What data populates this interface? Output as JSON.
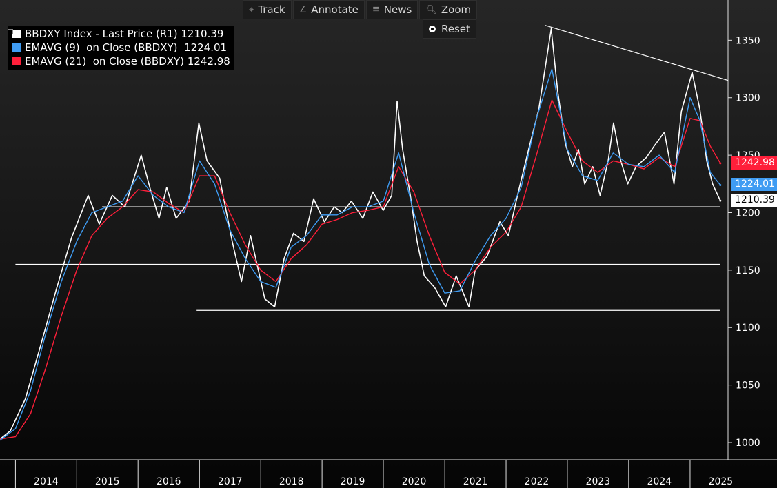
{
  "toolbar": {
    "items": [
      {
        "label": "Track",
        "icon": "crosshair-icon",
        "glyph": "⌖"
      },
      {
        "label": "Annotate",
        "icon": "pencil-icon",
        "glyph": "∠"
      },
      {
        "label": "News",
        "icon": "news-icon",
        "glyph": "≣"
      },
      {
        "label": "Zoom",
        "icon": "magnifier-icon",
        "glyph": "🔍︎"
      }
    ],
    "reset_label": "Reset"
  },
  "legend": {
    "entries": [
      {
        "label": "BBDXY Index - Last Price (R1) 1210.39",
        "color": "#ffffff"
      },
      {
        "label": "EMAVG (9)  on Close (BBDXY)  1224.01",
        "color": "#3f9cf3"
      },
      {
        "label": "EMAVG (21)  on Close (BBDXY) 1242.98",
        "color": "#ff1f3a"
      }
    ]
  },
  "price_tags": {
    "ema21": {
      "text": "1242.98",
      "value": 1242.98,
      "bg": "#ff1f3a",
      "fg": "#ffffff"
    },
    "ema9": {
      "text": "1224.01",
      "value": 1224.01,
      "bg": "#3f9cf3",
      "fg": "#ffffff"
    },
    "last": {
      "text": "1210.39",
      "value": 1210.39,
      "bg": "#ffffff",
      "fg": "#000000"
    }
  },
  "chart_data": {
    "type": "line",
    "title": "",
    "xlabel": "",
    "ylabel": "",
    "ylim": [
      985,
      1385
    ],
    "xlim": [
      "2013-10-01",
      "2025-08-15"
    ],
    "y_ticks": [
      1000,
      1050,
      1100,
      1150,
      1200,
      1250,
      1300,
      1350
    ],
    "x_ticks": [
      "2014",
      "2015",
      "2016",
      "2017",
      "2018",
      "2019",
      "2020",
      "2021",
      "2022",
      "2023",
      "2024",
      "2025"
    ],
    "grid": false,
    "legend_position": "top-left",
    "price_axis_side": "right",
    "series": [
      {
        "name": "BBDXY Index - Last Price (R1)",
        "color": "#ffffff",
        "x": [
          "2013-10-01",
          "2013-12-01",
          "2014-03-01",
          "2014-06-01",
          "2014-09-01",
          "2014-12-01",
          "2015-03-10",
          "2015-05-15",
          "2015-08-01",
          "2015-10-15",
          "2016-01-20",
          "2016-03-15",
          "2016-05-05",
          "2016-06-20",
          "2016-08-15",
          "2016-11-01",
          "2016-12-28",
          "2017-02-15",
          "2017-05-01",
          "2017-07-15",
          "2017-09-08",
          "2017-11-01",
          "2018-01-25",
          "2018-03-25",
          "2018-05-20",
          "2018-07-15",
          "2018-09-15",
          "2018-11-12",
          "2019-01-15",
          "2019-03-15",
          "2019-05-01",
          "2019-06-25",
          "2019-09-01",
          "2019-10-31",
          "2019-12-31",
          "2020-02-20",
          "2020-03-23",
          "2020-04-25",
          "2020-06-10",
          "2020-07-20",
          "2020-09-01",
          "2020-11-01",
          "2021-01-06",
          "2021-03-10",
          "2021-05-25",
          "2021-07-01",
          "2021-09-10",
          "2021-11-25",
          "2022-01-15",
          "2022-03-10",
          "2022-05-15",
          "2022-07-15",
          "2022-09-27",
          "2022-11-05",
          "2022-12-20",
          "2023-01-31",
          "2023-03-08",
          "2023-04-14",
          "2023-06-01",
          "2023-07-15",
          "2023-09-01",
          "2023-10-03",
          "2023-11-15",
          "2023-12-27",
          "2024-02-14",
          "2024-04-16",
          "2024-06-01",
          "2024-08-01",
          "2024-09-27",
          "2024-11-10",
          "2025-01-13",
          "2025-02-28",
          "2025-04-10",
          "2025-05-15",
          "2025-06-30"
        ],
        "y": [
          1003,
          1010,
          1038,
          1085,
          1133,
          1178,
          1215,
          1190,
          1215,
          1205,
          1250,
          1220,
          1195,
          1222,
          1195,
          1210,
          1278,
          1245,
          1230,
          1175,
          1140,
          1180,
          1125,
          1118,
          1160,
          1182,
          1175,
          1212,
          1192,
          1205,
          1200,
          1210,
          1195,
          1218,
          1202,
          1215,
          1297,
          1255,
          1215,
          1175,
          1145,
          1135,
          1118,
          1145,
          1118,
          1150,
          1162,
          1192,
          1180,
          1215,
          1255,
          1290,
          1360,
          1305,
          1260,
          1240,
          1255,
          1225,
          1240,
          1215,
          1245,
          1278,
          1245,
          1225,
          1240,
          1248,
          1258,
          1270,
          1225,
          1288,
          1322,
          1290,
          1245,
          1225,
          1210.39
        ]
      },
      {
        "name": "EMAVG (9) on Close (BBDXY)",
        "color": "#3f9cf3",
        "x": [
          "2013-10-01",
          "2014-01-01",
          "2014-04-01",
          "2014-07-01",
          "2014-10-01",
          "2015-01-01",
          "2015-04-01",
          "2015-07-01",
          "2015-10-01",
          "2016-01-01",
          "2016-04-01",
          "2016-07-01",
          "2016-10-01",
          "2017-01-01",
          "2017-04-01",
          "2017-07-01",
          "2017-10-01",
          "2018-01-01",
          "2018-04-01",
          "2018-07-01",
          "2018-10-01",
          "2019-01-01",
          "2019-04-01",
          "2019-07-01",
          "2019-10-01",
          "2020-01-01",
          "2020-04-01",
          "2020-07-01",
          "2020-10-01",
          "2021-01-01",
          "2021-04-01",
          "2021-07-01",
          "2021-10-01",
          "2022-01-01",
          "2022-04-01",
          "2022-07-01",
          "2022-10-01",
          "2023-01-01",
          "2023-04-01",
          "2023-07-01",
          "2023-10-01",
          "2024-01-01",
          "2024-04-01",
          "2024-07-01",
          "2024-10-01",
          "2025-01-01",
          "2025-03-01",
          "2025-05-01",
          "2025-06-30"
        ],
        "y": [
          1002,
          1012,
          1045,
          1095,
          1140,
          1175,
          1200,
          1205,
          1210,
          1232,
          1215,
          1205,
          1200,
          1245,
          1225,
          1185,
          1160,
          1140,
          1135,
          1170,
          1180,
          1198,
          1198,
          1205,
          1205,
          1210,
          1252,
          1200,
          1155,
          1130,
          1132,
          1158,
          1180,
          1195,
          1222,
          1282,
          1325,
          1255,
          1232,
          1228,
          1252,
          1242,
          1240,
          1250,
          1235,
          1300,
          1280,
          1235,
          1224.01
        ]
      },
      {
        "name": "EMAVG (21) on Close (BBDXY)",
        "color": "#ff1f3a",
        "x": [
          "2013-10-01",
          "2014-01-01",
          "2014-04-01",
          "2014-07-01",
          "2014-10-01",
          "2015-01-01",
          "2015-04-01",
          "2015-07-01",
          "2015-10-01",
          "2016-01-01",
          "2016-04-01",
          "2016-07-01",
          "2016-10-01",
          "2017-01-01",
          "2017-04-01",
          "2017-07-01",
          "2017-10-01",
          "2018-01-01",
          "2018-04-01",
          "2018-07-01",
          "2018-10-01",
          "2019-01-01",
          "2019-04-01",
          "2019-07-01",
          "2019-10-01",
          "2020-01-01",
          "2020-04-01",
          "2020-07-01",
          "2020-10-01",
          "2021-01-01",
          "2021-04-01",
          "2021-07-01",
          "2021-10-01",
          "2022-01-01",
          "2022-04-01",
          "2022-07-01",
          "2022-10-01",
          "2023-01-01",
          "2023-04-01",
          "2023-07-01",
          "2023-10-01",
          "2024-01-01",
          "2024-04-01",
          "2024-07-01",
          "2024-10-01",
          "2025-01-01",
          "2025-03-01",
          "2025-05-01",
          "2025-06-30"
        ],
        "y": [
          1003,
          1005,
          1025,
          1065,
          1110,
          1150,
          1180,
          1195,
          1205,
          1220,
          1218,
          1208,
          1200,
          1232,
          1232,
          1200,
          1172,
          1150,
          1140,
          1160,
          1172,
          1190,
          1194,
          1200,
          1202,
          1205,
          1240,
          1218,
          1180,
          1148,
          1138,
          1150,
          1170,
          1183,
          1205,
          1250,
          1298,
          1270,
          1245,
          1235,
          1245,
          1242,
          1238,
          1248,
          1240,
          1282,
          1280,
          1258,
          1242.98
        ]
      }
    ],
    "reference_lines": [
      {
        "type": "horizontal",
        "y": 1205,
        "x_start": "2015-06-01",
        "x_end": "2025-06-30"
      },
      {
        "type": "horizontal",
        "y": 1155,
        "x_start": "2014-01-01",
        "x_end": "2025-06-30"
      },
      {
        "type": "horizontal",
        "y": 1115,
        "x_start": "2016-12-15",
        "x_end": "2025-06-30"
      },
      {
        "type": "trendline",
        "points": [
          {
            "x": "2022-08-22",
            "y": 1363
          },
          {
            "x": "2025-08-15",
            "y": 1315
          }
        ]
      }
    ]
  }
}
